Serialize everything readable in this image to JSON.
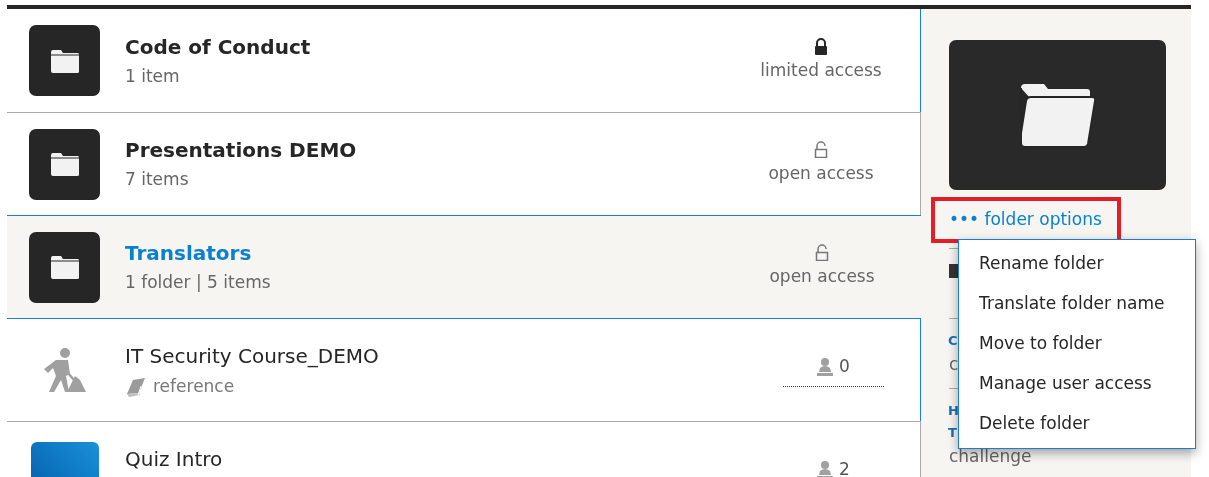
{
  "rows": [
    {
      "kind": "folder",
      "title": "Code of Conduct",
      "subtitle": "1 item",
      "locked": true,
      "access": "limited access",
      "selected": false
    },
    {
      "kind": "folder",
      "title": "Presentations DEMO",
      "subtitle": "7 items",
      "locked": false,
      "access": "open access",
      "selected": false
    },
    {
      "kind": "folder",
      "title": "Translators",
      "subtitle": "1 folder | 5 items",
      "locked": false,
      "access": "open access",
      "selected": true
    },
    {
      "kind": "course",
      "title": "IT Security Course_DEMO",
      "subtitle": "reference",
      "count": "0",
      "selected": false
    },
    {
      "kind": "course",
      "title": "Quiz Intro",
      "count": "2",
      "selected": false
    }
  ],
  "details": {
    "options_link": "••• folder options",
    "entries": [
      {
        "title_lines": [
          "C"
        ],
        "subtitle": "c"
      },
      {
        "title_lines": [
          "H",
          "T"
        ],
        "subtitle": "challenge"
      }
    ]
  },
  "menu": {
    "items": [
      "Rename folder",
      "Translate folder name",
      "Move to folder",
      "Manage user access",
      "Delete folder"
    ]
  }
}
